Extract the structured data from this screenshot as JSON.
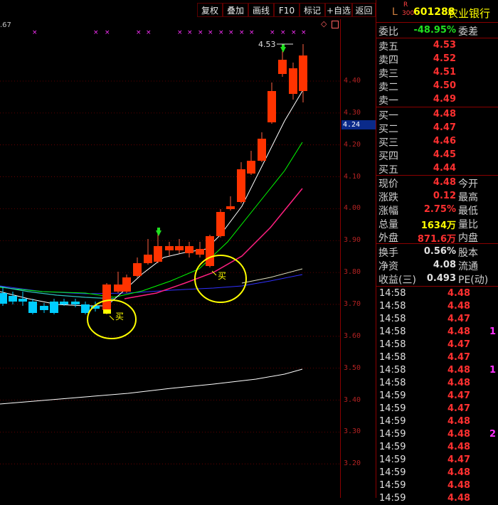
{
  "toolbar": {
    "buttons": [
      "复权",
      "叠加",
      "画线",
      "F10",
      "标记",
      "+自选",
      "返回"
    ],
    "icons": [
      "diamond-icon",
      "square-icon"
    ]
  },
  "top_label": ".67",
  "axis_labels": [
    "4.40",
    "4.30",
    "4.20",
    "4.10",
    "4.00",
    "3.90",
    "3.80",
    "3.70",
    "3.60",
    "3.50",
    "3.40",
    "3.30",
    "3.20"
  ],
  "current_price_label": "4.24",
  "peak_label": "4.53",
  "buy_marker_text": "买",
  "colors": {
    "up": "#ff3300",
    "down": "#00ccff",
    "ma5": "#ffffff",
    "ma10": "#ffff00",
    "ma20": "#00ff00",
    "ma30": "#ff2080",
    "ma60": "#3030ff",
    "ma120": "#ffffff",
    "circle": "#ffff00",
    "grid": "#8b0000"
  },
  "header": {
    "flag_l": "L",
    "flag_r": "R",
    "flag_r_num": "300",
    "code": "601288",
    "name": "农业银行"
  },
  "weibi": {
    "label": "委比",
    "value": "-48.95%",
    "label2": "委差"
  },
  "asks": [
    {
      "label": "卖五",
      "price": "4.53"
    },
    {
      "label": "卖四",
      "price": "4.52"
    },
    {
      "label": "卖三",
      "price": "4.51"
    },
    {
      "label": "卖二",
      "price": "4.50"
    },
    {
      "label": "卖一",
      "price": "4.49"
    }
  ],
  "bids": [
    {
      "label": "买一",
      "price": "4.48"
    },
    {
      "label": "买二",
      "price": "4.47"
    },
    {
      "label": "买三",
      "price": "4.46"
    },
    {
      "label": "买四",
      "price": "4.45"
    },
    {
      "label": "买五",
      "price": "4.44"
    }
  ],
  "quote": [
    {
      "label": "现价",
      "value": "4.48",
      "color": "red",
      "label2": "今开"
    },
    {
      "label": "涨跌",
      "value": "0.12",
      "color": "red",
      "label2": "最高"
    },
    {
      "label": "涨幅",
      "value": "2.75%",
      "color": "red",
      "label2": "最低"
    },
    {
      "label": "总量",
      "value": "1634万",
      "color": "yellow",
      "label2": "量比"
    },
    {
      "label": "外盘",
      "value": "871.6万",
      "color": "red",
      "label2": "内盘"
    }
  ],
  "fundamentals": [
    {
      "label": "换手",
      "value": "0.56%",
      "label2": "股本"
    },
    {
      "label": "净资",
      "value": "4.08",
      "label2": "流通"
    },
    {
      "label": "收益(三)",
      "value": "0.493",
      "label2": "PE(动)"
    }
  ],
  "ticks": [
    {
      "time": "14:58",
      "price": "4.48",
      "pc": "red",
      "vol": "",
      "vc": "magenta"
    },
    {
      "time": "14:58",
      "price": "4.48",
      "pc": "red",
      "vol": "",
      "vc": "magenta"
    },
    {
      "time": "14:58",
      "price": "4.47",
      "pc": "red",
      "vol": "",
      "vc": "magenta"
    },
    {
      "time": "14:58",
      "price": "4.48",
      "pc": "red",
      "vol": "1",
      "vc": "magenta"
    },
    {
      "time": "14:58",
      "price": "4.47",
      "pc": "red",
      "vol": "",
      "vc": "magenta"
    },
    {
      "time": "14:58",
      "price": "4.47",
      "pc": "red",
      "vol": "",
      "vc": "magenta"
    },
    {
      "time": "14:58",
      "price": "4.48",
      "pc": "red",
      "vol": "1",
      "vc": "magenta"
    },
    {
      "time": "14:58",
      "price": "4.48",
      "pc": "red",
      "vol": "",
      "vc": "magenta"
    },
    {
      "time": "14:59",
      "price": "4.47",
      "pc": "red",
      "vol": "",
      "vc": "magenta"
    },
    {
      "time": "14:59",
      "price": "4.47",
      "pc": "red",
      "vol": "",
      "vc": "magenta"
    },
    {
      "time": "14:59",
      "price": "4.48",
      "pc": "red",
      "vol": "",
      "vc": "magenta"
    },
    {
      "time": "14:59",
      "price": "4.48",
      "pc": "red",
      "vol": "2",
      "vc": "magenta"
    },
    {
      "time": "14:59",
      "price": "4.48",
      "pc": "red",
      "vol": "",
      "vc": "magenta"
    },
    {
      "time": "14:59",
      "price": "4.47",
      "pc": "red",
      "vol": "",
      "vc": "magenta"
    },
    {
      "time": "14:59",
      "price": "4.48",
      "pc": "red",
      "vol": "",
      "vc": "magenta"
    },
    {
      "time": "14:59",
      "price": "4.48",
      "pc": "red",
      "vol": "",
      "vc": "magenta"
    },
    {
      "time": "14:59",
      "price": "4.48",
      "pc": "red",
      "vol": "",
      "vc": "magenta"
    }
  ]
}
